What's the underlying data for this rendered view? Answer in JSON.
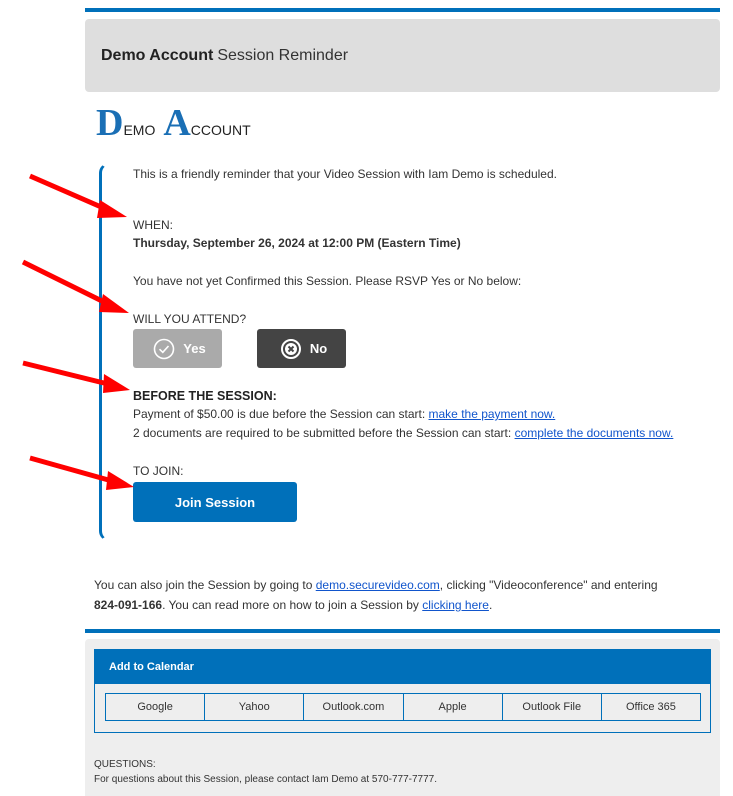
{
  "header": {
    "brand": "Demo Account",
    "title": "Session Reminder"
  },
  "logo": {
    "initial1": "D",
    "rest1": "EMO",
    "initial2": "A",
    "rest2": "CCOUNT"
  },
  "reminder": {
    "intro": "This is a friendly reminder that your Video Session with Iam Demo is scheduled.",
    "when_label": "WHEN:",
    "when_value": "Thursday, September 26, 2024 at 12:00 PM (Eastern Time)",
    "not_confirmed": "You have not yet Confirmed this Session. Please RSVP Yes or No below:",
    "attend_label": "WILL YOU ATTEND?",
    "yes_label": "Yes",
    "no_label": "No",
    "before_label": "BEFORE THE SESSION:",
    "payment_text": "Payment of $50.00 is due before the Session can start: ",
    "payment_link": "make the payment now.",
    "documents_text": "2 documents are required to be submitted before the Session can start: ",
    "documents_link": "complete the documents now.",
    "join_label": "TO JOIN:",
    "join_button": "Join Session"
  },
  "also_join": {
    "text1": "You can also join the Session by going to ",
    "site_link": "demo.securevideo.com",
    "text2": ", clicking \"Videoconference\" and entering",
    "code": "824-091-166",
    "text3": ". You can read more on how to join a Session by ",
    "help_link": "clicking here",
    "text4": "."
  },
  "calendar": {
    "title": "Add to Calendar",
    "options": [
      "Google",
      "Yahoo",
      "Outlook.com",
      "Apple",
      "Outlook File",
      "Office 365"
    ]
  },
  "questions": {
    "label": "QUESTIONS:",
    "text": "For questions about this Session, please contact Iam Demo at 570-777-7777."
  },
  "colors": {
    "brand_blue": "#0070BA",
    "arrow_red": "#FF0000",
    "yes_gray": "#AAAAAA",
    "no_dark": "#444444"
  }
}
